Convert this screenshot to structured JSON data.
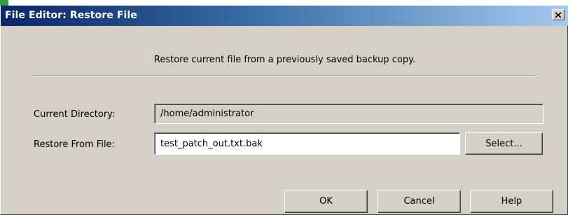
{
  "window": {
    "title": "File Editor: Restore File",
    "close_symbol": "×"
  },
  "instruction": "Restore current file from a previously saved backup copy.",
  "form": {
    "current_directory_label": "Current Directory:",
    "current_directory_value": "/home/administrator",
    "restore_from_label": "Restore From File:",
    "restore_from_value": "test_patch_out.txt.bak"
  },
  "buttons": {
    "select": "Select...",
    "ok": "OK",
    "cancel": "Cancel",
    "help": "Help"
  },
  "colors": {
    "titlebar_start": "#0a246a",
    "titlebar_end": "#a6caf0",
    "dialog_bg": "#d4d0c8"
  },
  "icons": {
    "close": "close-icon"
  }
}
